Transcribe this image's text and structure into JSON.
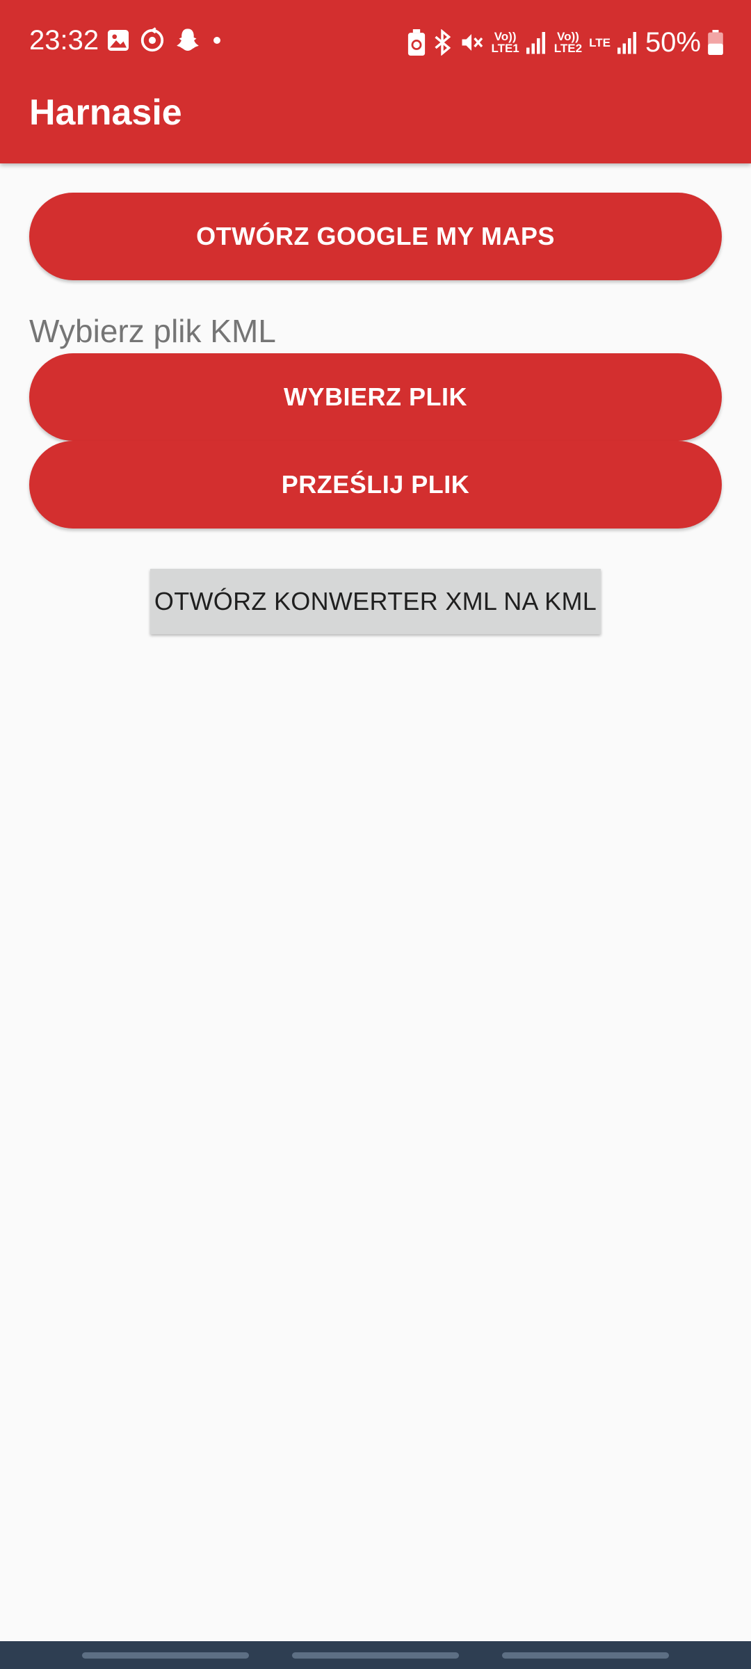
{
  "status_bar": {
    "time": "23:32",
    "left_icons": [
      "image-icon",
      "sync-icon",
      "snapchat-icon",
      "dot-icon"
    ],
    "right_icons": [
      "battery-saver-icon",
      "bluetooth-icon",
      "mute-icon"
    ],
    "sim1_label": "Vo))\nLTE1",
    "sim2_label": "Vo))\nLTE2",
    "lte_label": "LTE",
    "battery_percent": "50%"
  },
  "app_bar": {
    "title": "Harnasie",
    "color": "#d32f2f"
  },
  "main": {
    "open_maps_button": "OTWÓRZ GOOGLE MY MAPS",
    "kml_label": "Wybierz plik KML",
    "choose_file_button": "WYBIERZ PLIK",
    "upload_file_button": "PRZEŚLIJ PLIK",
    "converter_button": "OTWÓRZ KONWERTER XML NA KML"
  },
  "colors": {
    "accent": "#d32f2f",
    "background": "#fafafa",
    "gray_button": "#d6d7d7",
    "nav_bar": "#2e3e52"
  }
}
